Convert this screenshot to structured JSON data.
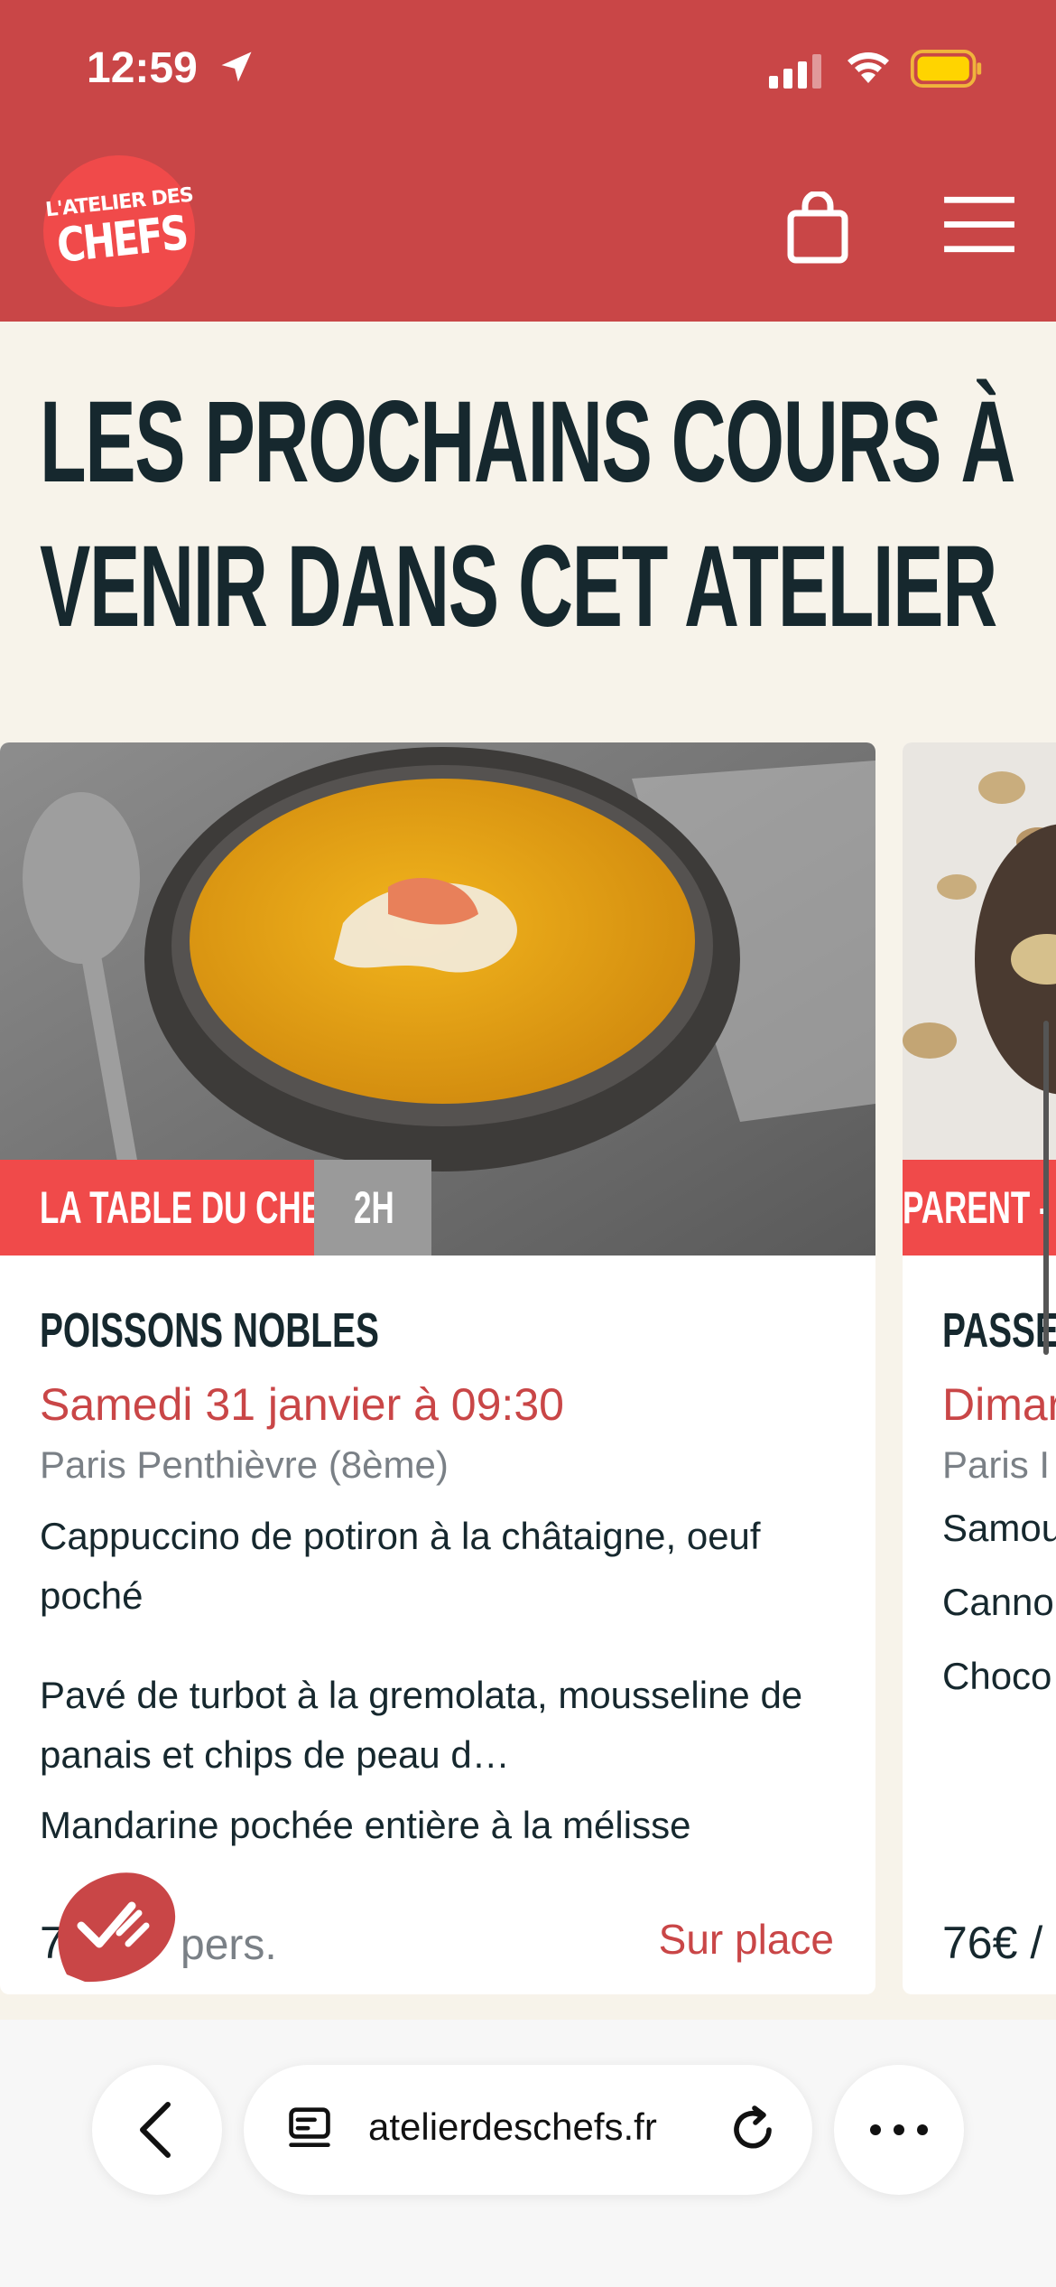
{
  "status_bar": {
    "time": "12:59"
  },
  "header": {
    "logo_top": "L'ATELIER DES",
    "logo_bottom": "CHEFS",
    "cart_icon": "shopping-bag-icon",
    "menu_icon": "hamburger-menu-icon",
    "bg_color": "#c94647"
  },
  "page": {
    "heading": "LES PROCHAINS COURS À VENIR DANS CET ATELIER"
  },
  "cards": [
    {
      "tag_type": "LA TABLE DU CHEF",
      "tag_duration": "2H",
      "name": "POISSONS NOBLES",
      "date": "Samedi 31 janvier à 09:30",
      "place": "Paris Penthièvre (8ème)",
      "menu": [
        "Cappuccino de potiron à la châtaigne, oeuf poché",
        "Pavé de turbot à la gremolata, mousseline de panais et chips de peau d…",
        "Mandarine pochée entière à la mélisse"
      ],
      "price_visible": "7",
      "per": "pers.",
      "mode": "Sur place"
    },
    {
      "tag_type": "PARENT -",
      "name": "PASSEP",
      "date": "Dimar",
      "place": "Paris I",
      "menu": [
        "Samou",
        "Canno",
        "Choco"
      ],
      "price": "76€ /"
    }
  ],
  "browser": {
    "url": "atelierdeschefs.fr",
    "back_icon": "chevron-left-icon",
    "tabs_icon": "tabs-icon",
    "reload_icon": "reload-icon",
    "more_icon": "more-dots-icon"
  },
  "colors": {
    "accent": "#f04a4a",
    "red": "#c94647",
    "dark": "#16282e",
    "cream": "#f7f3ea"
  }
}
